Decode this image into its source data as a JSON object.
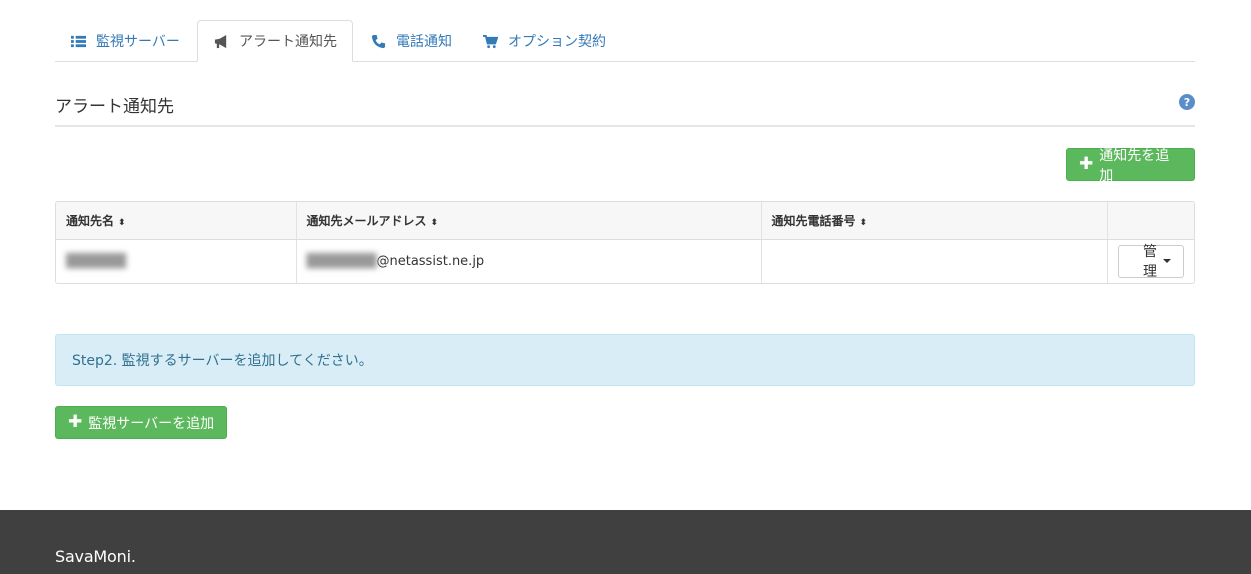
{
  "tabs": [
    {
      "label": "監視サーバー",
      "icon": "list-icon",
      "active": false
    },
    {
      "label": "アラート通知先",
      "icon": "bullhorn-icon",
      "active": true
    },
    {
      "label": "電話通知",
      "icon": "phone-icon",
      "active": false
    },
    {
      "label": "オプション契約",
      "icon": "cart-icon",
      "active": false
    }
  ],
  "section": {
    "title": "アラート通知先",
    "help": "?"
  },
  "buttons": {
    "add_contact": "通知先を追加",
    "add_server": "監視サーバーを追加",
    "manage": "管理"
  },
  "table": {
    "headers": [
      "通知先名",
      "通知先メールアドレス",
      "通知先電話番号",
      ""
    ],
    "sort_glyph": "⬍",
    "rows": [
      {
        "name_redacted": "hidden",
        "email_local_redacted": "hidden",
        "email_domain": "@netassist.ne.jp",
        "phone": ""
      }
    ]
  },
  "alert": {
    "text": "Step2. 監視するサーバーを追加してください。"
  },
  "footer": {
    "brand": "SavaMoni."
  },
  "colors": {
    "accent": "#337ab7",
    "success": "#5cb85c",
    "info_bg": "#d9edf7",
    "info_text": "#31708f",
    "footer_bg": "#404040"
  }
}
